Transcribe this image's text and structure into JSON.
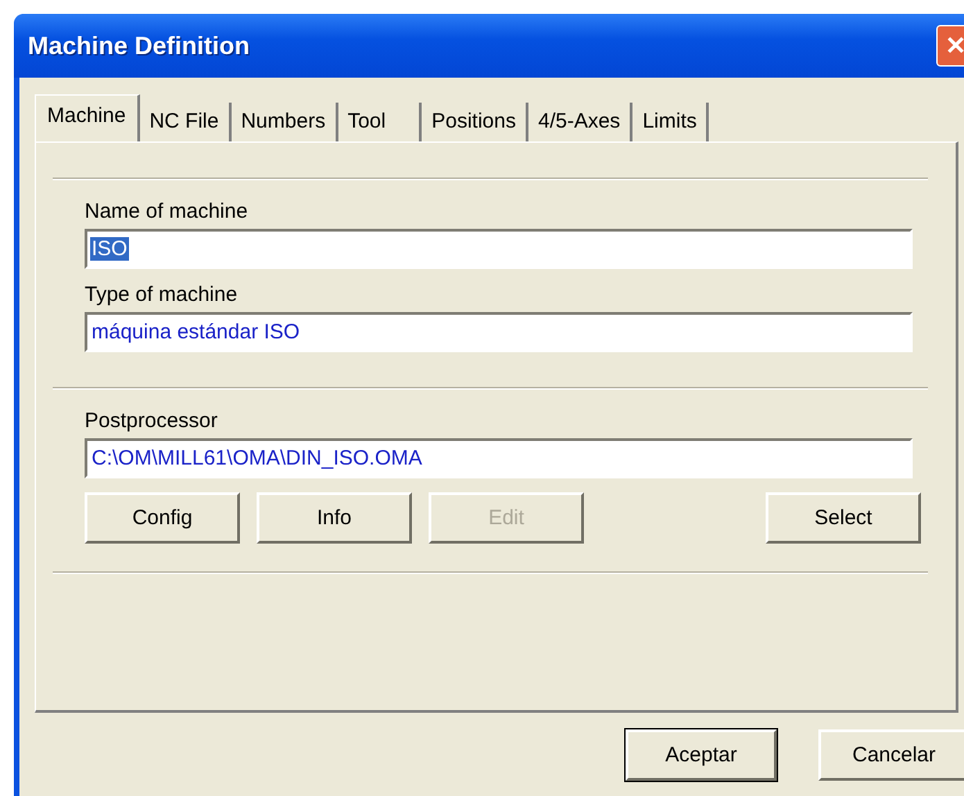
{
  "window": {
    "title": "Machine Definition",
    "close": "✕"
  },
  "tabs": [
    {
      "label": "Machine",
      "selected": true
    },
    {
      "label": "NC File",
      "selected": false
    },
    {
      "label": "Numbers",
      "selected": false
    },
    {
      "label": "Tool",
      "selected": false
    },
    {
      "label": "Positions",
      "selected": false
    },
    {
      "label": "4/5-Axes",
      "selected": false
    },
    {
      "label": "Limits",
      "selected": false
    }
  ],
  "sections": [
    {
      "fields": [
        {
          "label": "Name of machine",
          "value": "ISO",
          "text_selected": true
        },
        {
          "label": "Type of machine",
          "value": "máquina estándar ISO",
          "text_selected": false
        }
      ]
    },
    {
      "fields": [
        {
          "label": "Postprocessor",
          "value": "C:\\OM\\MILL61\\OMA\\DIN_ISO.OMA",
          "text_selected": false
        }
      ],
      "buttons": [
        {
          "label": "Config",
          "disabled": false
        },
        {
          "label": "Info",
          "disabled": false
        },
        {
          "label": "Edit",
          "disabled": true
        },
        {
          "label": "Select",
          "disabled": false
        }
      ]
    }
  ],
  "dialog_buttons": [
    {
      "label": "Aceptar",
      "default": true
    },
    {
      "label": "Cancelar",
      "default": false
    }
  ]
}
